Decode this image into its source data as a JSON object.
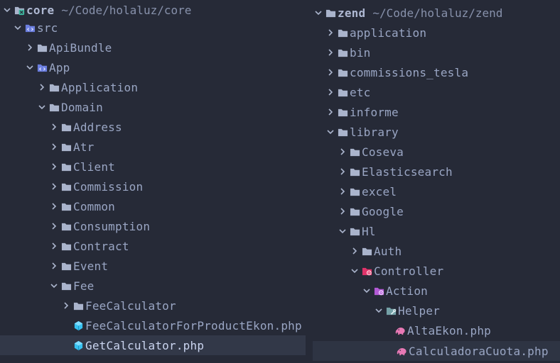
{
  "colors": {
    "background": "#262a37",
    "text": "#9aa6c4",
    "folder": "#aab4cc",
    "source_folder": "#6c7fe0",
    "controller_folder": "#e0336a",
    "action_folder": "#b35ad6",
    "helper_folder": "#74a1a7",
    "php_class_icon": "#37c1f0",
    "php_elephant_icon": "#e879b5",
    "selection": "#323848"
  },
  "left_tree": {
    "root": {
      "name": "core",
      "path": "~/Code/holaluz/core",
      "icon": "module-folder-icon"
    },
    "nodes": [
      {
        "label": "src",
        "icon": "source-folder-icon",
        "expanded": true
      },
      {
        "label": "ApiBundle",
        "icon": "folder-icon",
        "expanded": false
      },
      {
        "label": "App",
        "icon": "source-folder-icon",
        "expanded": true
      },
      {
        "label": "Application",
        "icon": "folder-icon",
        "expanded": false
      },
      {
        "label": "Domain",
        "icon": "folder-icon",
        "expanded": true
      },
      {
        "label": "Address",
        "icon": "folder-icon",
        "expanded": false
      },
      {
        "label": "Atr",
        "icon": "folder-icon",
        "expanded": false
      },
      {
        "label": "Client",
        "icon": "folder-icon",
        "expanded": false
      },
      {
        "label": "Commission",
        "icon": "folder-icon",
        "expanded": false
      },
      {
        "label": "Common",
        "icon": "folder-icon",
        "expanded": false
      },
      {
        "label": "Consumption",
        "icon": "folder-icon",
        "expanded": false
      },
      {
        "label": "Contract",
        "icon": "folder-icon",
        "expanded": false
      },
      {
        "label": "Event",
        "icon": "folder-icon",
        "expanded": false
      },
      {
        "label": "Fee",
        "icon": "folder-icon",
        "expanded": true
      },
      {
        "label": "FeeCalculator",
        "icon": "folder-icon",
        "expanded": false
      },
      {
        "label": "FeeCalculatorForProductEkon.php",
        "icon": "php-class-icon"
      },
      {
        "label": "GetCalculator.php",
        "icon": "php-class-icon",
        "selected": true
      }
    ]
  },
  "right_tree": {
    "root": {
      "name": "zend",
      "path": "~/Code/holaluz/zend",
      "icon": "folder-icon"
    },
    "nodes": [
      {
        "label": "application",
        "icon": "folder-icon",
        "expanded": false
      },
      {
        "label": "bin",
        "icon": "folder-icon",
        "expanded": false
      },
      {
        "label": "commissions_tesla",
        "icon": "folder-icon",
        "expanded": false
      },
      {
        "label": "etc",
        "icon": "folder-icon",
        "expanded": false
      },
      {
        "label": "informe",
        "icon": "folder-icon",
        "expanded": false
      },
      {
        "label": "library",
        "icon": "folder-icon",
        "expanded": true
      },
      {
        "label": "Coseva",
        "icon": "folder-icon",
        "expanded": false
      },
      {
        "label": "Elasticsearch",
        "icon": "folder-icon",
        "expanded": false
      },
      {
        "label": "excel",
        "icon": "folder-icon",
        "expanded": false
      },
      {
        "label": "Google",
        "icon": "folder-icon",
        "expanded": false
      },
      {
        "label": "Hl",
        "icon": "folder-icon",
        "expanded": true
      },
      {
        "label": "Auth",
        "icon": "folder-icon",
        "expanded": false
      },
      {
        "label": "Controller",
        "icon": "controller-folder-icon",
        "expanded": true
      },
      {
        "label": "Action",
        "icon": "action-folder-icon",
        "expanded": true
      },
      {
        "label": "Helper",
        "icon": "helper-folder-icon",
        "expanded": true
      },
      {
        "label": "AltaEkon.php",
        "icon": "php-elephant-icon"
      },
      {
        "label": "CalculadoraCuota.php",
        "icon": "php-elephant-icon",
        "selected": true
      }
    ]
  }
}
